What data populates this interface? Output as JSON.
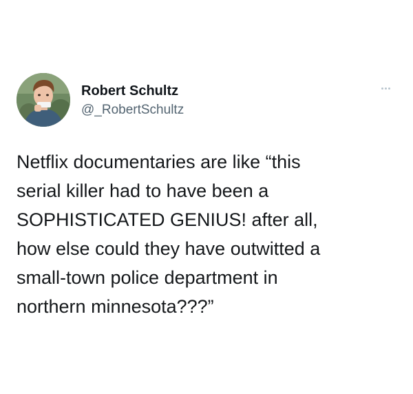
{
  "tweet": {
    "author": {
      "display_name": "Robert Schultz",
      "handle": "@_RobertSchultz",
      "avatar_icon": "profile-photo"
    },
    "more_icon": "more-options-icon",
    "text_lines": [
      "Netflix documentaries are like “this",
      "serial killer had to have been a",
      "SOPHISTICATED GENIUS! after all,",
      "how else could they have outwitted a",
      "small-town police department in",
      "northern minnesota???”"
    ]
  },
  "colors": {
    "background": "#ffffff",
    "name_text": "#0f1419",
    "handle_text": "#536471",
    "body_text": "#14171a",
    "more_dots": "#b8c4cd"
  }
}
